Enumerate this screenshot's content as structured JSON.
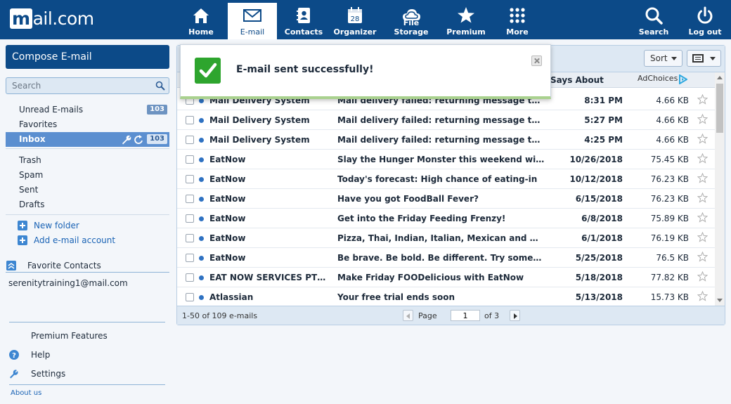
{
  "brand": {
    "logo_text": "mail.com",
    "logo_initial": "m",
    "logo_rest": "ail.com"
  },
  "nav": {
    "home": "Home",
    "email": "E-mail",
    "contacts": "Contacts",
    "organizer": "Organizer",
    "organizer_day": "28",
    "file_storage": "File Storage",
    "premium": "Premium",
    "more": "More",
    "search": "Search",
    "logout": "Log out",
    "active": "E-mail"
  },
  "sidebar": {
    "compose": "Compose E-mail",
    "search_placeholder": "Search",
    "folders": [
      {
        "label": "Unread E-mails",
        "count": "103"
      },
      {
        "label": "Favorites"
      },
      {
        "label": "Inbox",
        "count": "103",
        "selected": true
      },
      {
        "label": "Trash"
      },
      {
        "label": "Spam"
      },
      {
        "label": "Sent"
      },
      {
        "label": "Drafts"
      }
    ],
    "new_folder": "New folder",
    "add_account": "Add e-mail account",
    "favorite_contacts": "Favorite Contacts",
    "contact": "serenitytraining1@mail.com",
    "premium_features": "Premium Features",
    "help": "Help",
    "settings": "Settings",
    "about": "About us"
  },
  "toolbar": {
    "sort": "Sort"
  },
  "columns": {
    "says_about": "Says About",
    "adchoices": "AdChoices"
  },
  "emails": [
    {
      "from": "Mail Delivery System",
      "subject": "Mail delivery failed: returning message to sen…",
      "date": "8:31 PM",
      "size": "4.66 KB"
    },
    {
      "from": "Mail Delivery System",
      "subject": "Mail delivery failed: returning message to sen…",
      "date": "5:27 PM",
      "size": "4.66 KB"
    },
    {
      "from": "Mail Delivery System",
      "subject": "Mail delivery failed: returning message to sen…",
      "date": "4:25 PM",
      "size": "4.66 KB"
    },
    {
      "from": "EatNow",
      "subject": "Slay the Hunger Monster this weekend with u…",
      "date": "10/26/2018",
      "size": "75.45 KB"
    },
    {
      "from": "EatNow",
      "subject": "Today's forecast: High chance of eating-in",
      "date": "10/12/2018",
      "size": "76.23 KB"
    },
    {
      "from": "EatNow",
      "subject": "Have you got FoodBall Fever?",
      "date": "6/15/2018",
      "size": "76.23 KB"
    },
    {
      "from": "EatNow",
      "subject": "Get into the Friday Feeding Frenzy!",
      "date": "6/8/2018",
      "size": "75.89 KB"
    },
    {
      "from": "EatNow",
      "subject": "Pizza, Thai, Indian, Italian, Mexican and more…",
      "date": "6/1/2018",
      "size": "76.19 KB"
    },
    {
      "from": "EatNow",
      "subject": "Be brave. Be bold. Be different. Try somethin…",
      "date": "5/25/2018",
      "size": "76.5 KB"
    },
    {
      "from": "EAT NOW SERVICES PTY …",
      "subject": "Make Friday FOODelicious with EatNow",
      "date": "5/18/2018",
      "size": "77.82 KB"
    },
    {
      "from": "Atlassian",
      "subject": "Your free trial ends soon",
      "date": "5/13/2018",
      "size": "15.73 KB"
    }
  ],
  "footer": {
    "count": "1-50 of 109 e-mails",
    "page_label": "Page",
    "page_value": "1",
    "of_pages": "of 3"
  },
  "toast": {
    "message": "E-mail sent successfully!"
  },
  "colors": {
    "brand": "#0c4a88",
    "accent": "#5b8fd0",
    "success": "#2ea52e"
  }
}
